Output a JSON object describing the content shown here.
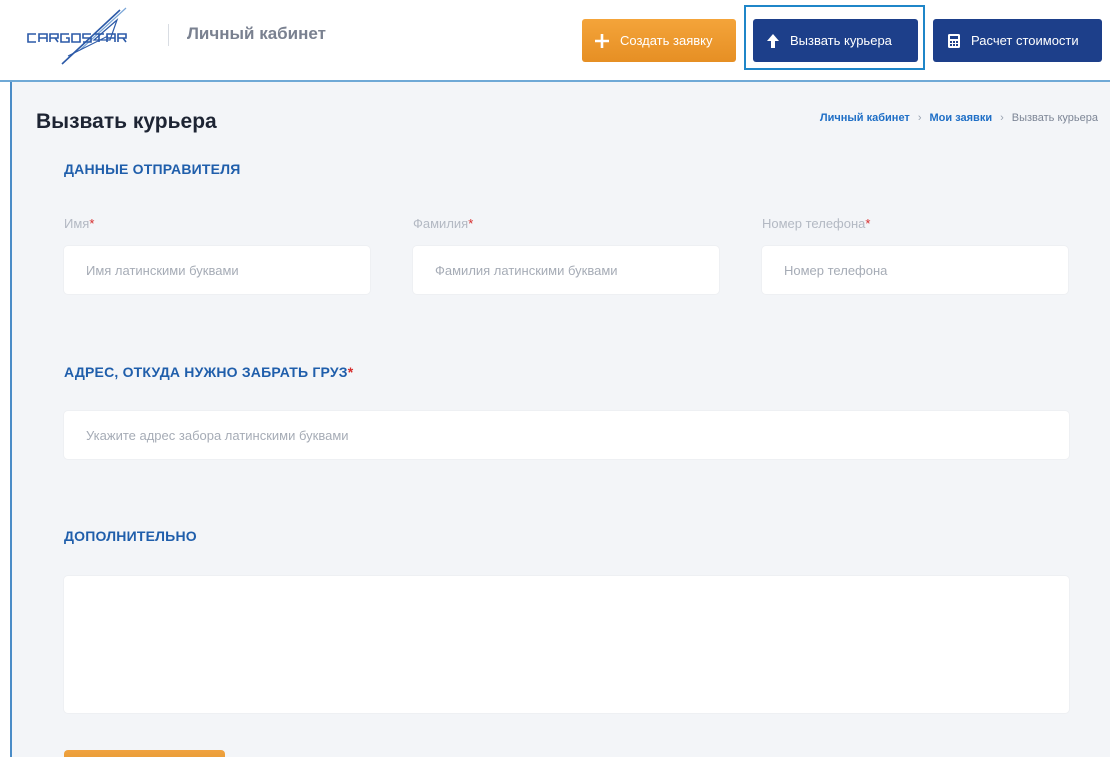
{
  "brand": {
    "logo_text": "CARGO STAR",
    "cabinet_title": "Личный кабинет"
  },
  "header": {
    "create_label": "Создать заявку",
    "courier_label": "Вызвать курьера",
    "calc_label": "Расчет стоимости",
    "create_icon": "plus-icon",
    "courier_icon": "arrow-up-icon",
    "calc_icon": "calculator-icon"
  },
  "page": {
    "title": "Вызвать курьера",
    "breadcrumb": [
      "Личный кабинет",
      "Мои заявки",
      "Вызвать курьера"
    ]
  },
  "sender": {
    "section_title": "ДАННЫЕ ОТПРАВИТЕЛЯ",
    "first_name_label": "Имя",
    "first_name_placeholder": "Имя латинскими буквами",
    "last_name_label": "Фамилия",
    "last_name_placeholder": "Фамилия латинскими буквами",
    "phone_label": "Номер телефона",
    "phone_placeholder": "Номер телефона",
    "required_mark": "*"
  },
  "address": {
    "section_title": "АДРЕС, ОТКУДА НУЖНО ЗАБРАТЬ ГРУЗ",
    "placeholder": "Укажите адрес забора латинскими буквами",
    "required_mark": "*"
  },
  "extra": {
    "section_title": "ДОПОЛНИТЕЛЬНО",
    "value": ""
  },
  "colors": {
    "primary": "#1d3f8a",
    "accent": "#e68f24",
    "link": "#1f6fc6",
    "section": "#1f5eab",
    "required": "#d62b2b"
  }
}
